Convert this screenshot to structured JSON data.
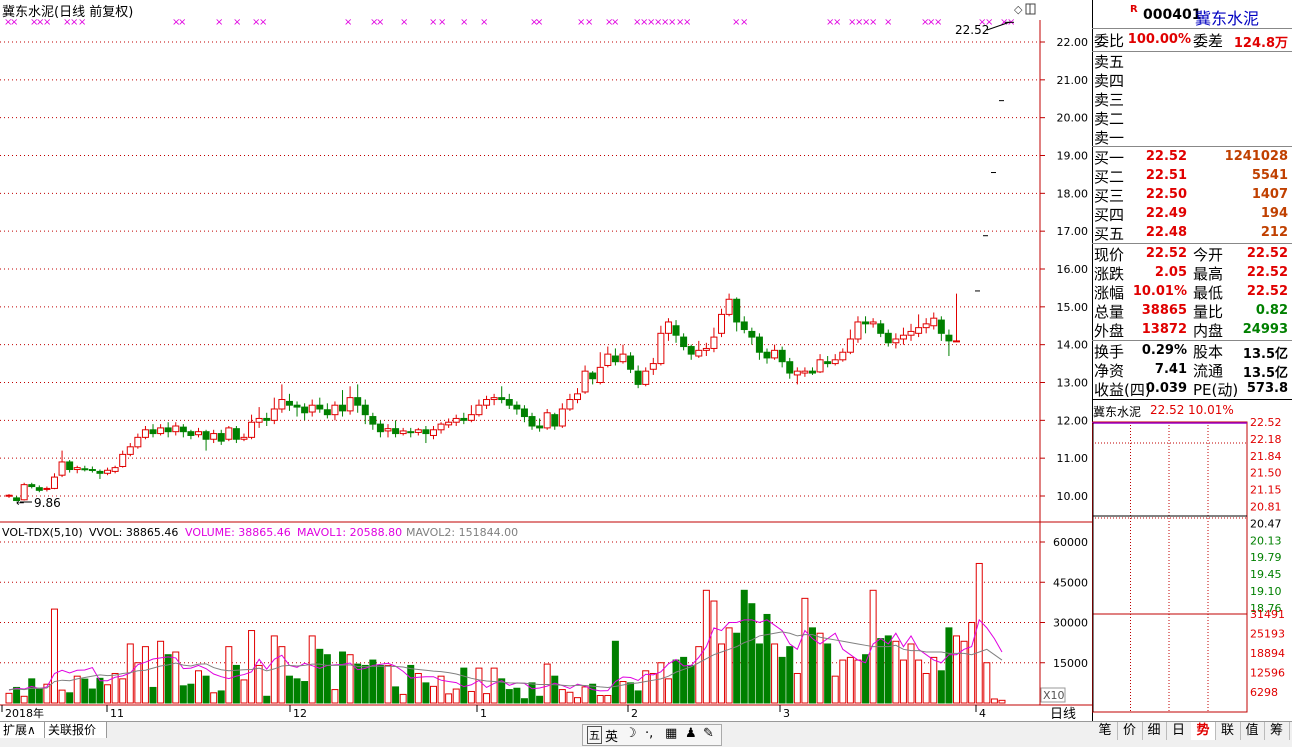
{
  "title": "冀东水泥(日线 前复权)",
  "price_axis": [
    "22.00",
    "21.00",
    "20.00",
    "19.00",
    "18.00",
    "17.00",
    "16.00",
    "15.00",
    "14.00",
    "13.00",
    "12.00",
    "11.00",
    "10.00"
  ],
  "last_price_label": "22.52",
  "low_label": "9.86",
  "vol_header": {
    "name": "VOL-TDX(5,10)",
    "vvol": "VVOL: 38865.46",
    "volume": "VOLUME: 38865.46",
    "mavol1": "MAVOL1: 20588.80",
    "mavol2": "MAVOL2: 151844.00"
  },
  "vol_axis": [
    "60000",
    "45000",
    "30000",
    "15000"
  ],
  "vol_unit": "X10",
  "month_labels": [
    "2018年",
    "11",
    "12",
    "1",
    "2",
    "3",
    "4"
  ],
  "period_label": "日线",
  "bottom_tabs": [
    "扩展∧",
    "关联报价"
  ],
  "right_tabs": [
    "笔",
    "价",
    "细",
    "日",
    "势",
    "联",
    "值",
    "筹"
  ],
  "ime": {
    "five": "五",
    "en": "英"
  },
  "quote": {
    "flag": "R",
    "code": "000401",
    "name": "冀东水泥",
    "weibi_label": "委比",
    "weibi": "100.00%",
    "weicha_label": "委差",
    "weicha": "124.8万",
    "sells": [
      "卖五",
      "卖四",
      "卖三",
      "卖二",
      "卖一"
    ],
    "buys": [
      {
        "label": "买一",
        "price": "22.52",
        "vol": "1241028"
      },
      {
        "label": "买二",
        "price": "22.51",
        "vol": "5541"
      },
      {
        "label": "买三",
        "price": "22.50",
        "vol": "1407"
      },
      {
        "label": "买四",
        "price": "22.49",
        "vol": "194"
      },
      {
        "label": "买五",
        "price": "22.48",
        "vol": "212"
      }
    ],
    "stats1": [
      {
        "l1": "现价",
        "v1": "22.52",
        "l2": "今开",
        "v2": "22.52"
      },
      {
        "l1": "涨跌",
        "v1": "2.05",
        "l2": "最高",
        "v2": "22.52"
      },
      {
        "l1": "涨幅",
        "v1": "10.01%",
        "l2": "最低",
        "v2": "22.52"
      },
      {
        "l1": "总量",
        "v1": "38865",
        "l2": "量比",
        "v2": "0.82"
      },
      {
        "l1": "外盘",
        "v1": "13872",
        "l2": "内盘",
        "v2": "24993"
      }
    ],
    "stats2": [
      {
        "l1": "换手",
        "v1": "0.29%",
        "l2": "股本",
        "v2": "13.5亿"
      },
      {
        "l1": "净资",
        "v1": "7.41",
        "l2": "流通",
        "v2": "13.5亿"
      },
      {
        "l1": "收益(四)",
        "v1": "0.039",
        "l2": "PE(动)",
        "v2": "573.8"
      }
    ],
    "mini": {
      "name": "冀东水泥",
      "price": "22.52",
      "pct": "10.01%",
      "price_ticks": [
        "22.52",
        "22.18",
        "21.84",
        "21.50",
        "21.15",
        "20.81",
        "20.47",
        "20.13",
        "19.79",
        "19.45",
        "19.10",
        "18.76"
      ],
      "vol_ticks": [
        "31491",
        "25193",
        "18894",
        "12596",
        "6298"
      ]
    }
  },
  "colors": {
    "up": "#e00000",
    "down": "#008000",
    "ma1": "#e000e0",
    "ma2": "#808080",
    "grid": "#c00000"
  },
  "chart_data": {
    "type": "candlestick",
    "candles": [
      [
        10.0,
        10.02,
        10.05,
        9.95
      ],
      [
        9.95,
        9.88,
        10.0,
        9.86
      ],
      [
        9.9,
        10.3,
        10.35,
        9.88
      ],
      [
        10.3,
        10.25,
        10.35,
        10.2
      ],
      [
        10.22,
        10.15,
        10.28,
        10.1
      ],
      [
        10.18,
        10.2,
        10.25,
        10.12
      ],
      [
        10.2,
        10.5,
        10.6,
        10.18
      ],
      [
        10.55,
        10.9,
        11.2,
        10.5
      ],
      [
        10.9,
        10.7,
        10.95,
        10.62
      ],
      [
        10.7,
        10.75,
        10.8,
        10.6
      ],
      [
        10.72,
        10.7,
        10.8,
        10.65
      ],
      [
        10.7,
        10.68,
        10.78,
        10.62
      ],
      [
        10.65,
        10.6,
        10.7,
        10.45
      ],
      [
        10.6,
        10.68,
        10.75,
        10.55
      ],
      [
        10.65,
        10.75,
        10.8,
        10.6
      ],
      [
        10.78,
        11.1,
        11.2,
        10.75
      ],
      [
        11.1,
        11.3,
        11.4,
        11.05
      ],
      [
        11.3,
        11.55,
        11.65,
        11.25
      ],
      [
        11.55,
        11.75,
        11.85,
        11.5
      ],
      [
        11.75,
        11.65,
        11.9,
        11.55
      ],
      [
        11.65,
        11.8,
        11.9,
        11.6
      ],
      [
        11.8,
        11.7,
        11.95,
        11.55
      ],
      [
        11.7,
        11.85,
        11.95,
        11.6
      ],
      [
        11.82,
        11.7,
        11.9,
        11.55
      ],
      [
        11.7,
        11.6,
        11.75,
        11.5
      ],
      [
        11.62,
        11.7,
        11.8,
        11.55
      ],
      [
        11.7,
        11.5,
        11.75,
        11.2
      ],
      [
        11.5,
        11.65,
        11.75,
        11.4
      ],
      [
        11.65,
        11.45,
        11.75,
        11.35
      ],
      [
        11.5,
        11.8,
        11.85,
        11.45
      ],
      [
        11.78,
        11.5,
        11.85,
        11.4
      ],
      [
        11.5,
        11.55,
        11.65,
        11.45
      ],
      [
        11.55,
        11.95,
        12.15,
        11.5
      ],
      [
        11.95,
        12.05,
        12.35,
        11.8
      ],
      [
        12.05,
        12.0,
        12.2,
        11.85
      ],
      [
        12.0,
        12.3,
        12.6,
        11.9
      ],
      [
        12.3,
        12.55,
        12.95,
        12.2
      ],
      [
        12.5,
        12.4,
        12.7,
        12.25
      ],
      [
        12.4,
        12.35,
        12.5,
        12.1
      ],
      [
        12.35,
        12.2,
        12.45,
        12.0
      ],
      [
        12.22,
        12.4,
        12.55,
        12.1
      ],
      [
        12.4,
        12.3,
        12.6,
        12.2
      ],
      [
        12.28,
        12.15,
        12.45,
        12.05
      ],
      [
        12.15,
        12.4,
        12.5,
        12.0
      ],
      [
        12.4,
        12.25,
        12.8,
        12.1
      ],
      [
        12.25,
        12.6,
        12.9,
        12.15
      ],
      [
        12.6,
        12.4,
        12.95,
        12.2
      ],
      [
        12.4,
        12.15,
        12.55,
        11.9
      ],
      [
        12.1,
        11.9,
        12.2,
        11.75
      ],
      [
        11.9,
        11.7,
        12.0,
        11.55
      ],
      [
        11.72,
        11.78,
        11.9,
        11.55
      ],
      [
        11.78,
        11.65,
        12.0,
        11.55
      ],
      [
        11.65,
        11.72,
        11.8,
        11.6
      ],
      [
        11.7,
        11.68,
        11.8,
        11.55
      ],
      [
        11.68,
        11.75,
        11.8,
        11.6
      ],
      [
        11.75,
        11.65,
        11.85,
        11.4
      ],
      [
        11.6,
        11.75,
        11.85,
        11.5
      ],
      [
        11.75,
        11.9,
        11.95,
        11.65
      ],
      [
        11.88,
        11.95,
        12.05,
        11.8
      ],
      [
        11.95,
        12.05,
        12.15,
        11.85
      ],
      [
        12.05,
        12.0,
        12.2,
        11.9
      ],
      [
        12.0,
        12.15,
        12.4,
        11.95
      ],
      [
        12.15,
        12.4,
        12.55,
        12.1
      ],
      [
        12.4,
        12.55,
        12.65,
        12.3
      ],
      [
        12.55,
        12.6,
        12.7,
        12.4
      ],
      [
        12.6,
        12.55,
        12.9,
        12.45
      ],
      [
        12.55,
        12.4,
        12.7,
        12.3
      ],
      [
        12.4,
        12.3,
        12.5,
        12.15
      ],
      [
        12.3,
        12.1,
        12.4,
        11.95
      ],
      [
        12.1,
        11.85,
        12.2,
        11.75
      ],
      [
        11.85,
        11.8,
        12.05,
        11.7
      ],
      [
        11.8,
        12.2,
        12.3,
        11.75
      ],
      [
        12.15,
        11.85,
        12.2,
        11.75
      ],
      [
        11.85,
        12.3,
        12.45,
        11.8
      ],
      [
        12.3,
        12.55,
        12.7,
        12.25
      ],
      [
        12.55,
        12.7,
        12.85,
        12.45
      ],
      [
        12.75,
        13.3,
        13.45,
        12.7
      ],
      [
        13.25,
        13.1,
        13.3,
        12.95
      ],
      [
        13.0,
        13.4,
        13.8,
        12.95
      ],
      [
        13.45,
        13.75,
        13.95,
        13.4
      ],
      [
        13.7,
        13.55,
        13.9,
        13.45
      ],
      [
        13.55,
        13.75,
        14.0,
        13.5
      ],
      [
        13.7,
        13.35,
        13.8,
        13.25
      ],
      [
        13.3,
        12.95,
        13.45,
        12.85
      ],
      [
        12.95,
        13.3,
        13.4,
        12.9
      ],
      [
        13.35,
        13.5,
        13.65,
        13.2
      ],
      [
        13.5,
        14.3,
        14.5,
        13.45
      ],
      [
        14.3,
        14.6,
        14.7,
        14.1
      ],
      [
        14.5,
        14.25,
        14.65,
        14.05
      ],
      [
        14.2,
        13.95,
        14.3,
        13.85
      ],
      [
        13.95,
        13.75,
        14.0,
        13.6
      ],
      [
        13.7,
        13.85,
        14.1,
        13.65
      ],
      [
        13.85,
        13.9,
        14.05,
        13.7
      ],
      [
        13.9,
        14.2,
        14.45,
        13.8
      ],
      [
        14.3,
        14.8,
        14.95,
        14.2
      ],
      [
        14.8,
        15.2,
        15.35,
        14.75
      ],
      [
        15.2,
        14.6,
        15.25,
        14.35
      ],
      [
        14.6,
        14.4,
        14.75,
        14.3
      ],
      [
        14.35,
        14.2,
        14.45,
        14.0
      ],
      [
        14.2,
        13.8,
        14.3,
        13.6
      ],
      [
        13.8,
        13.65,
        13.9,
        13.5
      ],
      [
        13.65,
        13.85,
        14.0,
        13.6
      ],
      [
        13.85,
        13.55,
        13.95,
        13.4
      ],
      [
        13.55,
        13.25,
        13.65,
        13.1
      ],
      [
        13.2,
        13.3,
        13.4,
        12.95
      ],
      [
        13.25,
        13.3,
        13.4,
        13.15
      ],
      [
        13.3,
        13.25,
        13.4,
        13.2
      ],
      [
        13.28,
        13.6,
        13.75,
        13.25
      ],
      [
        13.55,
        13.5,
        13.7,
        13.4
      ],
      [
        13.5,
        13.6,
        13.75,
        13.45
      ],
      [
        13.6,
        13.8,
        13.9,
        13.55
      ],
      [
        13.8,
        14.15,
        14.4,
        13.75
      ],
      [
        14.15,
        14.6,
        14.75,
        14.05
      ],
      [
        14.6,
        14.55,
        14.75,
        14.3
      ],
      [
        14.55,
        14.6,
        14.7,
        14.45
      ],
      [
        14.55,
        14.3,
        14.65,
        14.2
      ],
      [
        14.3,
        14.05,
        14.4,
        13.95
      ],
      [
        14.05,
        14.15,
        14.3,
        13.9
      ],
      [
        14.15,
        14.25,
        14.45,
        14.0
      ],
      [
        14.25,
        14.35,
        14.55,
        14.1
      ],
      [
        14.3,
        14.45,
        14.8,
        14.2
      ],
      [
        14.45,
        14.55,
        14.7,
        14.3
      ],
      [
        14.5,
        14.7,
        14.85,
        14.4
      ],
      [
        14.65,
        14.3,
        14.75,
        14.1
      ],
      [
        14.25,
        14.1,
        14.4,
        13.7
      ],
      [
        14.1,
        14.1,
        15.35,
        14.1
      ],
      [
        14.3,
        14.3,
        14.3,
        14.3
      ],
      [
        14.3,
        14.3,
        14.3,
        14.3
      ],
      [
        14.3,
        14.3,
        14.3,
        14.3
      ],
      [
        14.3,
        14.3,
        14.3,
        14.3
      ],
      [
        14.3,
        14.3,
        14.3,
        14.3
      ],
      [
        14.3,
        14.3,
        14.3,
        14.3
      ]
    ],
    "limit_up_marks": [
      15.42,
      16.88,
      18.55,
      20.45
    ],
    "volumes": [
      3600,
      5800,
      2500,
      9000,
      5500,
      7000,
      35000,
      4800,
      3800,
      10000,
      8900,
      5200,
      9200,
      6800,
      11000,
      9000,
      22000,
      15000,
      21000,
      5800,
      23000,
      18000,
      19000,
      6400,
      7000,
      12000,
      10000,
      3800,
      4500,
      21000,
      14000,
      8600,
      27000,
      14000,
      2500,
      25000,
      21000,
      10000,
      9000,
      8000,
      25000,
      20000,
      18000,
      5000,
      19000,
      18000,
      14500,
      14000,
      16000,
      14000,
      14000,
      6000,
      3200,
      14000,
      11000,
      7500,
      6200,
      10000,
      3400,
      5200,
      13000,
      4300,
      13000,
      3500,
      13000,
      9000,
      5000,
      5500,
      1600,
      7500,
      2500,
      14500,
      10000,
      5000,
      4000,
      2000,
      6000,
      7000,
      2800,
      2800,
      23000,
      8000,
      7500,
      4500,
      12000,
      11000,
      15000,
      9000,
      16000,
      17000,
      14000,
      21000,
      42000,
      38000,
      22000,
      28000,
      26000,
      42000,
      37000,
      22000,
      33000,
      22000,
      17000,
      21000,
      11000,
      39000,
      28000,
      26000,
      22000,
      10000,
      16000,
      17000,
      16000,
      18000,
      42000,
      24000,
      25000,
      23000,
      16000,
      22000,
      16000,
      11000,
      17000,
      12000,
      28000,
      25000,
      23000,
      30000,
      52000,
      15000,
      1500,
      1000
    ],
    "ma5": [
      4800,
      5500,
      5200,
      6200,
      5300,
      6000,
      11000,
      12200,
      11200,
      12200,
      12300,
      13200,
      8300,
      8300,
      9600,
      10100,
      11200,
      14300,
      15200,
      16400,
      16800,
      17200,
      16800,
      12800,
      13000,
      14000,
      12800,
      10800,
      9800,
      9100,
      10000,
      10600,
      11600,
      16300,
      12600,
      16300,
      17800,
      14000,
      13300,
      14800,
      13900,
      12900,
      14000,
      14200,
      14400,
      14900,
      12400,
      12900,
      14000,
      14400,
      14800,
      13700,
      11800,
      9300,
      9600,
      9800,
      9800,
      8500,
      8000,
      7600,
      6100,
      6800,
      8400,
      5800,
      7300,
      8300,
      6600,
      7500,
      7300,
      5300,
      5600,
      6300,
      7400,
      6500,
      5400,
      7000,
      6300,
      5000,
      4500,
      4600,
      8000,
      9700,
      9500,
      8400,
      10700,
      10500,
      11600,
      14600,
      16200,
      13800,
      14000,
      17000,
      21000,
      28000,
      27000,
      30000,
      30000,
      31000,
      31000,
      30000,
      31000,
      29000,
      27000,
      22000,
      20000,
      27000,
      24000,
      22000,
      24000,
      26000,
      20000,
      18000,
      16000,
      15000,
      22000,
      24000,
      22000,
      26000,
      21000,
      25000,
      20000,
      18000,
      16000,
      15000,
      18000,
      18000,
      20000,
      21000,
      31000,
      28000,
      24000,
      19000
    ],
    "ma10": [
      5000,
      5200,
      5000,
      5500,
      5400,
      5600,
      8000,
      8500,
      8300,
      9000,
      9500,
      10000,
      10500,
      10200,
      10400,
      11000,
      11300,
      12000,
      12200,
      13000,
      13800,
      14200,
      14900,
      14100,
      13800,
      14500,
      14600,
      13200,
      12400,
      12000,
      12200,
      12400,
      12500,
      13000,
      12000,
      12700,
      13800,
      14000,
      13800,
      14000,
      14500,
      14500,
      14000,
      14000,
      14100,
      14200,
      13600,
      13500,
      13700,
      13700,
      13700,
      13600,
      13400,
      12800,
      12500,
      12200,
      11900,
      11700,
      11300,
      10800,
      10000,
      9200,
      8600,
      8200,
      8000,
      7800,
      7500,
      7400,
      7400,
      7100,
      6900,
      6900,
      6800,
      6600,
      6400,
      6600,
      6500,
      6300,
      6000,
      5800,
      6200,
      6700,
      7200,
      7500,
      8000,
      8500,
      9000,
      10000,
      11500,
      12500,
      13500,
      15000,
      16500,
      18000,
      19000,
      20000,
      21000,
      22500,
      23500,
      25000,
      25500,
      26000,
      26500,
      26000,
      25000,
      25500,
      25500,
      24500,
      24000,
      23500,
      23000,
      22500,
      22000,
      21500,
      21000,
      21000,
      21000,
      21500,
      20000,
      19500,
      19500,
      19000,
      19000,
      19000,
      18500,
      18500,
      18500,
      18000,
      19000,
      20000,
      18000,
      16000
    ]
  }
}
